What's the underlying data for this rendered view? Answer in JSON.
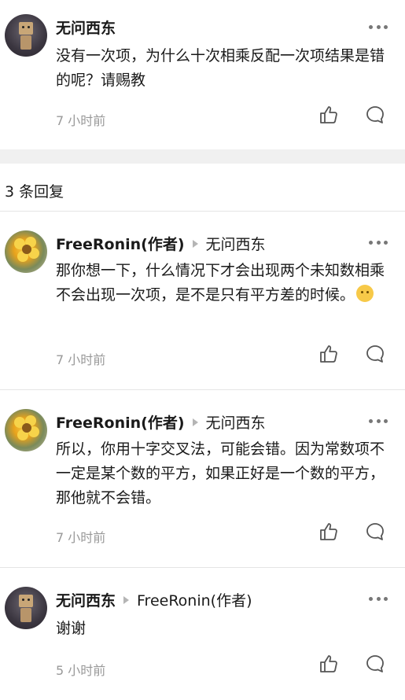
{
  "top_comment": {
    "author": "无问西东",
    "text": "没有一次项，为什么十次相乘反配一次项结果是错的呢？请赐教",
    "time": "7 小时前"
  },
  "reply_count_label": "3 条回复",
  "replies": [
    {
      "author": "FreeRonin(作者)",
      "reply_to": "无问西东",
      "text": "那你想一下，什么情况下才会出现两个未知数相乘不会出现一次项，是不是只有平方差的时候。",
      "emoji": "thinking-face",
      "time": "7 小时前"
    },
    {
      "author": "FreeRonin(作者)",
      "reply_to": "无问西东",
      "text": "所以，你用十字交叉法，可能会错。因为常数项不一定是某个数的平方，如果正好是一个数的平方，那他就不会错。",
      "time": "7 小时前"
    },
    {
      "author": "无问西东",
      "reply_to": "FreeRonin(作者)",
      "text": "谢谢",
      "time": "5 小时前"
    }
  ],
  "icons": {
    "like": "thumbs-up-icon",
    "reply": "speech-bubble-icon",
    "more": "more-dots-icon"
  },
  "colors": {
    "text_primary": "#1a1a1a",
    "text_secondary": "#999999",
    "divider": "#e5e5e5",
    "separator_band": "#f0f0f0"
  }
}
